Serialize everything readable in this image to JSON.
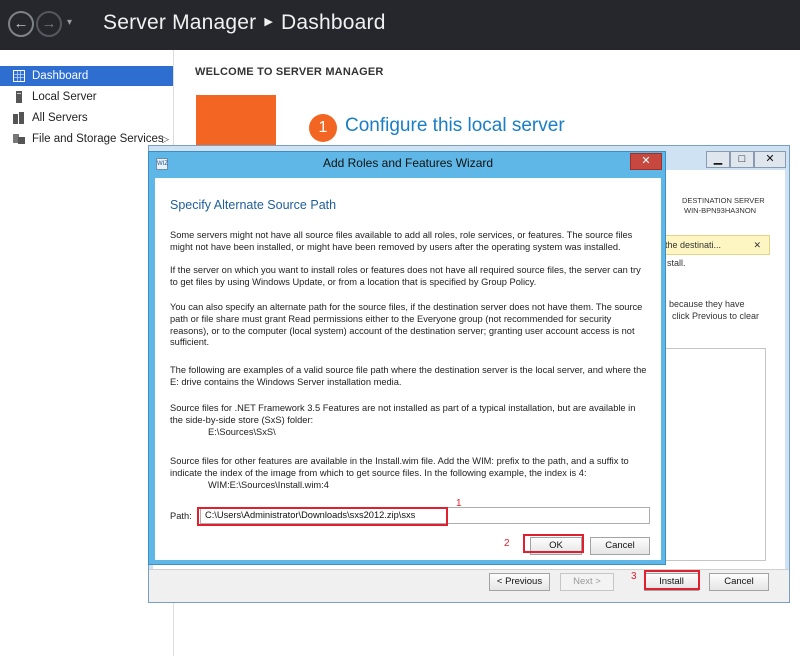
{
  "window": {
    "breadcrumb_app": "Server Manager",
    "breadcrumb_page": "Dashboard",
    "back_glyph": "←",
    "forward_glyph": "→",
    "dropdown_glyph": "▾"
  },
  "sidebar": {
    "items": [
      {
        "label": "Dashboard",
        "icon": "dashboard-grid-icon",
        "active": true
      },
      {
        "label": "Local Server",
        "icon": "server-icon"
      },
      {
        "label": "All Servers",
        "icon": "servers-icon"
      },
      {
        "label": "File and Storage Services",
        "icon": "storage-icon",
        "chevron": "▷"
      }
    ]
  },
  "main": {
    "welcome": "WELCOME TO SERVER MANAGER",
    "step_number": "1",
    "configure": "Configure this local server"
  },
  "background_wizard": {
    "minimize": "▁",
    "maximize": "□",
    "close": "✕",
    "destination_label": "DESTINATION SERVER",
    "destination_name": "WIN-BPN93HA3NON",
    "warning_text": "the destinati...",
    "warning_close": "✕",
    "text1": "stall.",
    "text2": "because they have",
    "text3": "click Previous to clear",
    "buttons": {
      "previous": "< Previous",
      "next": "Next >",
      "install": "Install",
      "cancel": "Cancel"
    }
  },
  "dialog": {
    "title": "Add Roles and Features Wizard",
    "close": "✕",
    "icon_text": "WIZ",
    "heading": "Specify Alternate Source Path",
    "paragraphs": [
      "Some servers might not have all source files available to add all roles, role services, or features. The source files might not have been installed, or might have been removed by users after the operating system was installed.",
      "If the server on which you want to install roles or features does not have all required source files, the server can try to get files by using Windows Update, or from a location that is specified by Group Policy.",
      "You can also specify an alternate path for the source files, if the destination server does not have them. The source path or file share must grant Read permissions either to the Everyone group (not recommended for security reasons), or to the computer (local system) account of the destination server; granting user account access is not sufficient.",
      "The following are examples of a valid source file path where the destination server is the local server, and where the E: drive contains the Windows Server installation media.",
      "Source files for .NET Framework 3.5 Features are not installed as part of a typical installation, but are available in the side-by-side store (SxS) folder:",
      "Source files for other features are available in the Install.wim file. Add the WIM: prefix to the path, and a suffix to indicate the index of the image from which to get source files. In the following example, the index is 4:"
    ],
    "example_sxs": "E:\\Sources\\SxS\\",
    "example_wim": "WIM:E:\\Sources\\Install.wim:4",
    "path_label": "Path:",
    "path_value": "C:\\Users\\Administrator\\Downloads\\sxs2012.zip\\sxs",
    "ok": "OK",
    "cancel": "Cancel"
  },
  "annotations": {
    "n1": "1",
    "n2": "2",
    "n3": "3",
    "color": "#e0202e"
  }
}
